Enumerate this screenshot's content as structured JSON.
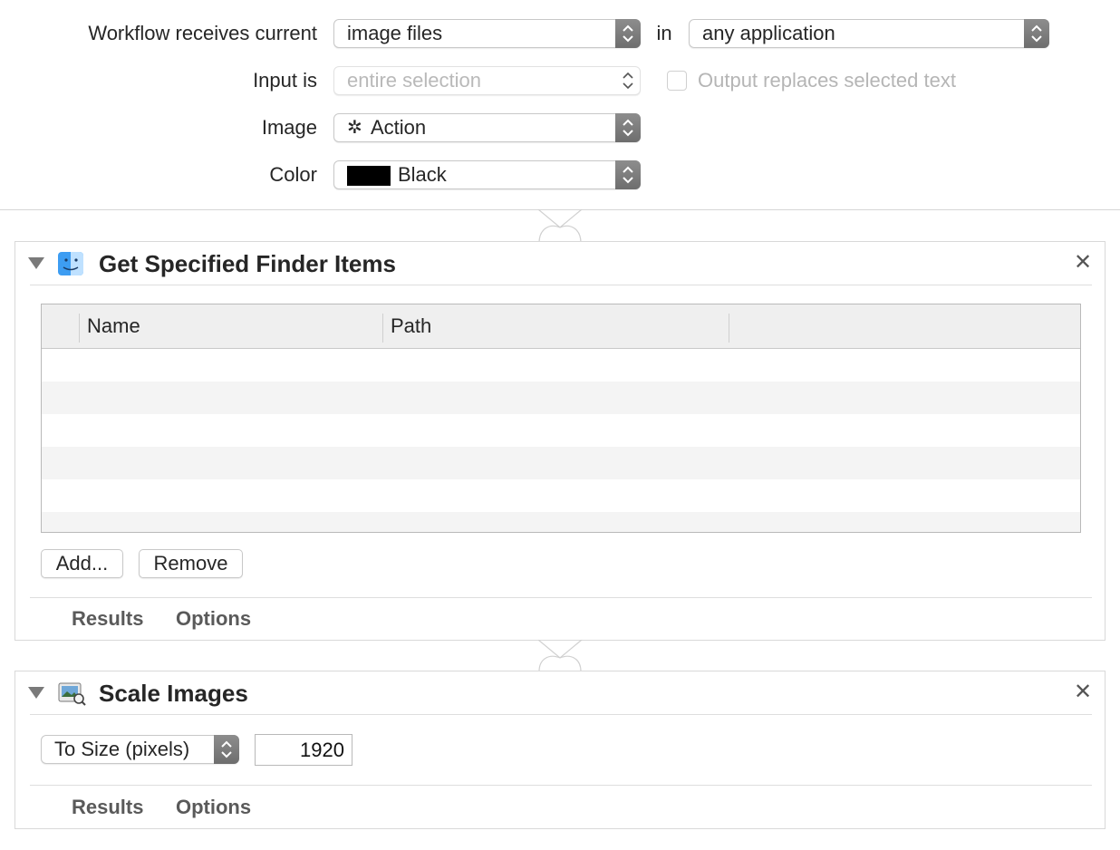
{
  "workflow": {
    "receives_label": "Workflow receives current",
    "receives_value": "image files",
    "in_label": "in",
    "application_value": "any application",
    "input_label": "Input is",
    "input_value": "entire selection",
    "output_replaces_label": "Output replaces selected text",
    "image_label": "Image",
    "image_value": "Action",
    "color_label": "Color",
    "color_value": "Black",
    "color_swatch": "#000000"
  },
  "actions": [
    {
      "title": "Get Specified Finder Items",
      "icon": "finder-icon",
      "table": {
        "columns": [
          "Name",
          "Path"
        ],
        "rows": []
      },
      "add_label": "Add...",
      "remove_label": "Remove",
      "results_label": "Results",
      "options_label": "Options"
    },
    {
      "title": "Scale Images",
      "icon": "preview-icon",
      "scale_mode": "To Size (pixels)",
      "size_value": "1920",
      "results_label": "Results",
      "options_label": "Options"
    }
  ]
}
